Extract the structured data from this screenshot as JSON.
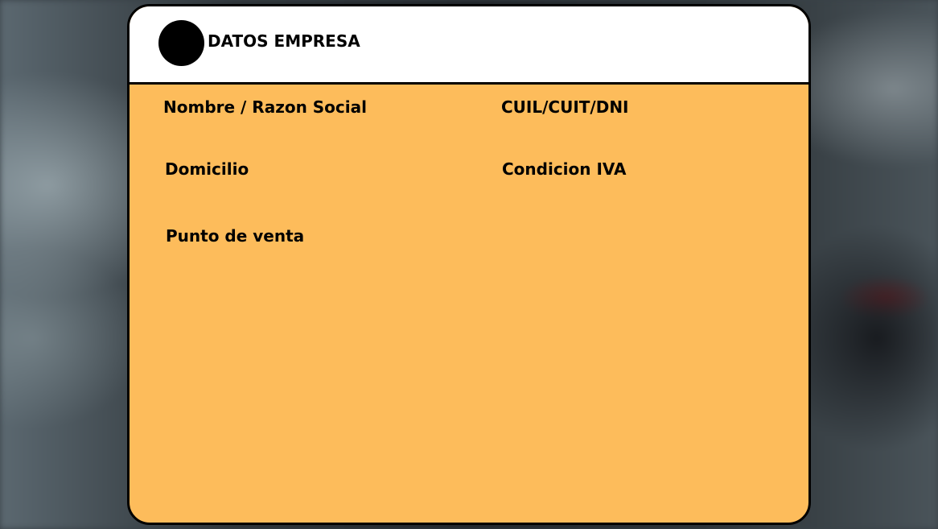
{
  "card": {
    "title": "DATOS EMPRESA",
    "fields": {
      "nombre_label": "Nombre / Razon Social",
      "cuil_label": "CUIL/CUIT/DNI",
      "domicilio_label": "Domicilio",
      "condicion_iva_label": "Condicion IVA",
      "punto_venta_label": "Punto de venta"
    }
  },
  "colors": {
    "card_body": "#fdbc5b",
    "card_header": "#ffffff",
    "border": "#000000"
  }
}
